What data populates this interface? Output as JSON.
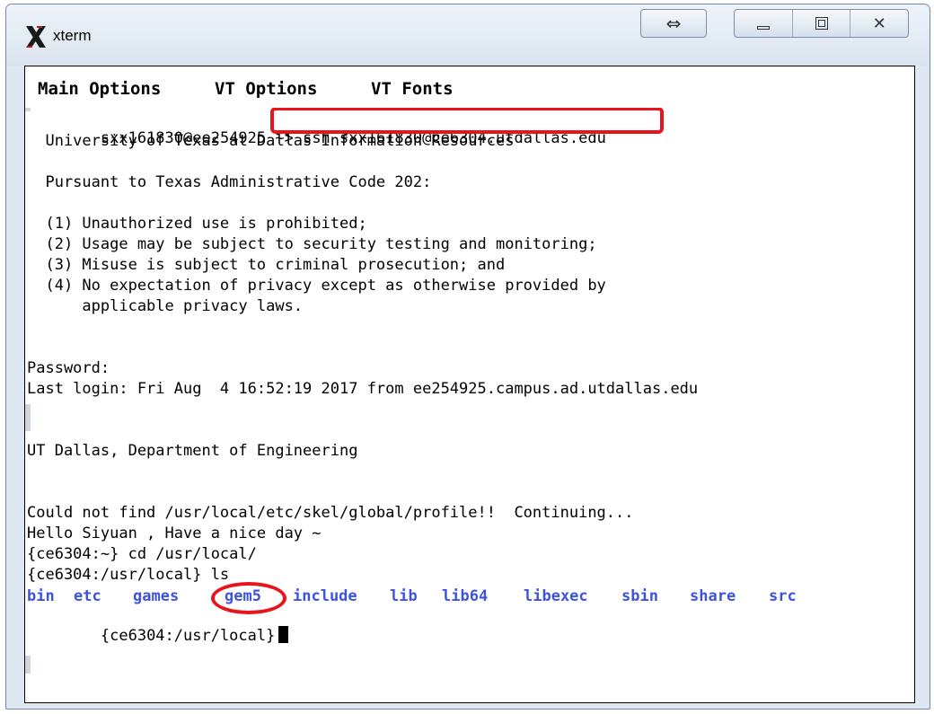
{
  "window": {
    "title": "xterm",
    "icons": {
      "app": "x-logo-icon",
      "move": "resize-arrows-icon",
      "minimize": "minimize-icon",
      "maximize": "maximize-icon",
      "close": "close-icon"
    },
    "move_glyph": "⇔",
    "close_glyph": "✕"
  },
  "menu": {
    "items": [
      "Main Options",
      "VT Options",
      "VT Fonts"
    ]
  },
  "terminal": {
    "prompt1": "sxx161830@ee254925 ~>",
    "ssh_command": "ssh sxx161830@ce6304.utdallas.edu",
    "lines": [
      "  University of Texas at Dallas Information Resources",
      "",
      "  Pursuant to Texas Administrative Code 202:",
      "",
      "  (1) Unauthorized use is prohibited;",
      "  (2) Usage may be subject to security testing and monitoring;",
      "  (3) Misuse is subject to criminal prosecution; and",
      "  (4) No expectation of privacy except as otherwise provided by",
      "      applicable privacy laws.",
      "",
      "Password:",
      "Last login: Fri Aug  4 16:52:19 2017 from ee254925.campus.ad.utdallas.edu",
      "",
      "UT Dallas, Department of Engineering",
      "",
      "Could not find /usr/local/etc/skel/global/profile!!  Continuing...",
      "Hello Siyuan , Have a nice day ~",
      "{ce6304:~} cd /usr/local/",
      "{ce6304:/usr/local} ls"
    ],
    "ls_output": [
      "bin",
      "etc",
      "games",
      "gem5",
      "include",
      "lib",
      "lib64",
      "libexec",
      "sbin",
      "share",
      "src"
    ],
    "final_prompt": "{ce6304:/usr/local}"
  },
  "colors": {
    "ls_directory": "#3c53e0",
    "annotation": "#e8141c"
  }
}
